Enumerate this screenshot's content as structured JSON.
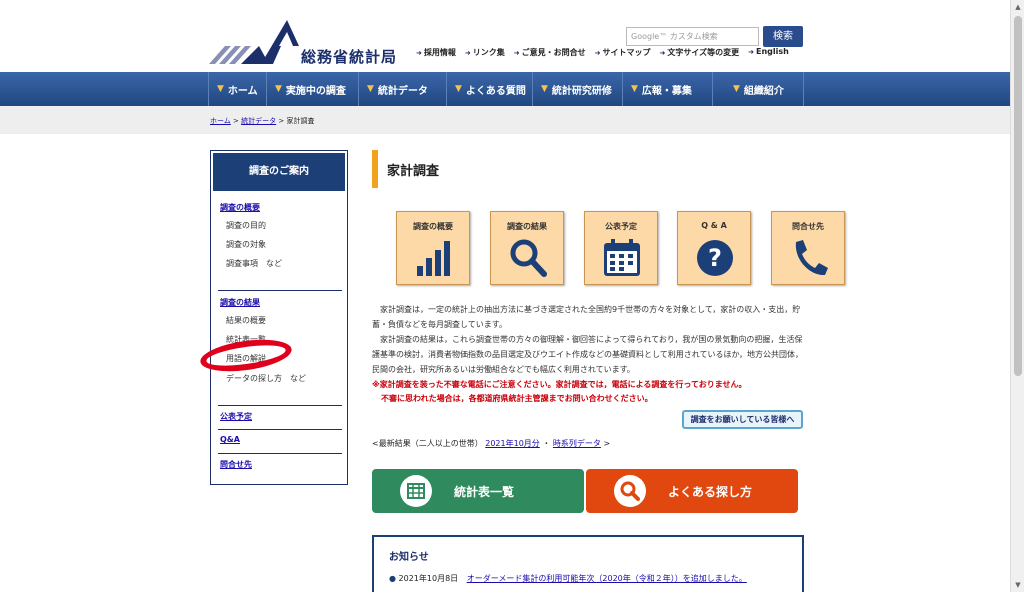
{
  "header": {
    "site_name": "総務省統計局",
    "search_placeholder": "Google™ カスタム検索",
    "search_button": "検索",
    "util_links": [
      "採用情報",
      "リンク集",
      "ご意見・お問合せ",
      "サイトマップ",
      "文字サイズ等の変更",
      "English"
    ]
  },
  "nav": {
    "items": [
      "ホーム",
      "実施中の調査",
      "統計データ",
      "よくある質問",
      "統計研究研修",
      "広報・募集",
      "組織紹介"
    ]
  },
  "breadcrumb": {
    "home": "ホーム",
    "sep1": ">",
    "stats": "統計データ",
    "sep2": ">",
    "current": "家計調査"
  },
  "sidebar": {
    "title": "調査のご案内",
    "section1_link": "調査の概要",
    "section1_items": [
      "調査の目的",
      "調査の対象",
      "調査事項　など"
    ],
    "section2_link": "調査の結果",
    "section2_items": [
      "結果の概要",
      "統計表一覧",
      "用語の解説",
      "データの探し方　など"
    ],
    "link_schedule": "公表予定",
    "link_qa": "Q&A",
    "link_contact": "問合せ先"
  },
  "main": {
    "title": "家計調査",
    "tiles": [
      "調査の概要",
      "調査の結果",
      "公表予定",
      "Q & A",
      "問合せ先"
    ],
    "intro_p1": "家計調査は，一定の統計上の抽出方法に基づき選定された全国約9千世帯の方々を対象として，家計の収入・支出，貯蓄・負債などを毎月調査しています。",
    "intro_p2": "家計調査の結果は，これら調査世帯の方々の御理解・御回答によって得られており，我が国の景気動向の把握，生活保護基準の検討，消費者物価指数の品目選定及びウエイト作成などの基礎資料として利用されているほか，地方公共団体，民間の会社，研究所あるいは労働組合などでも幅広く利用されています。",
    "warn1": "※家計調査を装った不審な電話にご注意ください。家計調査では，電話による調査を行っておりません。",
    "warn2": "不審に思われた場合は，各都道府県統計主管課までお問い合わせください。",
    "warn_button": "調査をお願いしている皆様へ",
    "latest_prefix": "<最新結果（二人以上の世帯）",
    "latest_link1": "2021年10月分",
    "latest_dot": "・",
    "latest_link2": "時系列データ",
    "latest_suffix": ">",
    "btn_tables": "統計表一覧",
    "btn_search": "よくある探し方",
    "btn_tables_color": "#2f8a5d",
    "btn_search_color": "#e0480f"
  },
  "news": {
    "title": "お知らせ",
    "item_date": "2021年10月8日",
    "item_text": "オーダーメード集計の利用可能年次（2020年（令和２年））を追加しました。"
  },
  "scrollbar": {
    "up": "▲",
    "down": "▼"
  }
}
